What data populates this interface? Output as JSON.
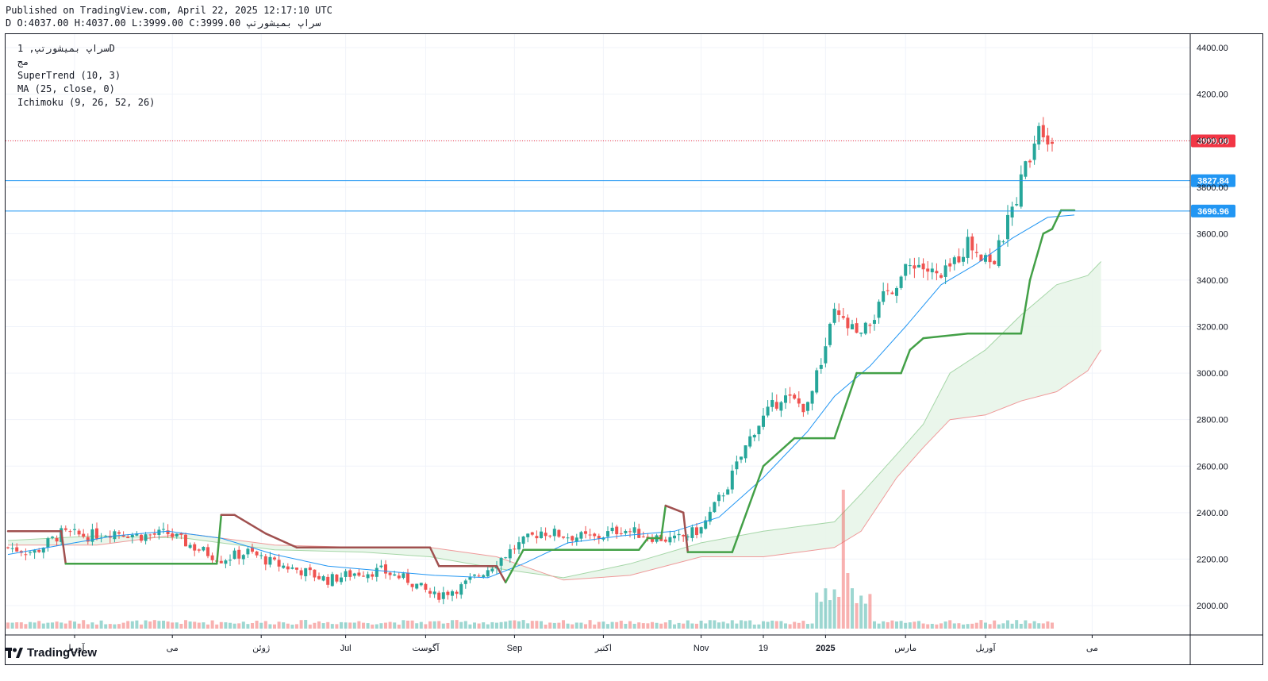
{
  "header": {
    "published": "Published on TradingView.com, April 22, 2025 12:17:10 UTC",
    "ohlc_line": "سراپ بمیشورتپ D O:4037.00 H:4037.00 L:3999.00 C:3999.00"
  },
  "legend": {
    "symbol": "سراپ بمیشورتپ, 1D",
    "exchange": "مج",
    "supertrend": "SuperTrend (10, 3)",
    "ma": "MA (25, close, 0)",
    "ichimoku": "Ichimoku (9, 26, 52, 26)"
  },
  "logo": {
    "text": "TradingView"
  },
  "chart_data": {
    "type": "candlestick",
    "ylim": [
      1950,
      4450
    ],
    "y_ticks": [
      2000,
      2200,
      2400,
      2600,
      2800,
      3000,
      3200,
      3400,
      3600,
      3800,
      4000,
      4200,
      4400
    ],
    "y_tick_labels": [
      "2000.00",
      "2200.00",
      "2400.00",
      "2600.00",
      "2800.00",
      "3000.00",
      "3200.00",
      "3400.00",
      "3600.00",
      "3800.00",
      "4000.00",
      "4200.00",
      "4400.00"
    ],
    "x_labels": [
      "آوریل",
      "می",
      "ژوئن",
      "Jul",
      "آگوست",
      "Sep",
      "اکتبر",
      "Nov",
      "19",
      "2025",
      "مارس",
      "آوریل",
      "می"
    ],
    "x_label_index": [
      15,
      37,
      57,
      76,
      94,
      114,
      134,
      156,
      170,
      184,
      202,
      220,
      244
    ],
    "n_bars": 236,
    "price_lines": [
      {
        "value": 3999.0,
        "label": "3999.00",
        "color": "#f23645",
        "style": "dotted"
      },
      {
        "value": 3827.84,
        "label": "3827.84",
        "color": "#2196f3",
        "style": "solid"
      },
      {
        "value": 3696.96,
        "label": "3696.96",
        "color": "#2196f3",
        "style": "solid"
      }
    ],
    "close_anchors": [
      [
        0,
        2250
      ],
      [
        6,
        2230
      ],
      [
        12,
        2310
      ],
      [
        18,
        2300
      ],
      [
        24,
        2320
      ],
      [
        30,
        2300
      ],
      [
        36,
        2310
      ],
      [
        42,
        2250
      ],
      [
        48,
        2200
      ],
      [
        54,
        2230
      ],
      [
        60,
        2180
      ],
      [
        66,
        2150
      ],
      [
        72,
        2110
      ],
      [
        78,
        2140
      ],
      [
        84,
        2150
      ],
      [
        90,
        2110
      ],
      [
        96,
        2040
      ],
      [
        102,
        2080
      ],
      [
        108,
        2160
      ],
      [
        114,
        2250
      ],
      [
        120,
        2320
      ],
      [
        126,
        2300
      ],
      [
        132,
        2290
      ],
      [
        138,
        2330
      ],
      [
        144,
        2300
      ],
      [
        150,
        2280
      ],
      [
        156,
        2330
      ],
      [
        162,
        2520
      ],
      [
        168,
        2760
      ],
      [
        174,
        2900
      ],
      [
        180,
        2850
      ],
      [
        186,
        3250
      ],
      [
        192,
        3150
      ],
      [
        198,
        3350
      ],
      [
        204,
        3480
      ],
      [
        210,
        3400
      ],
      [
        216,
        3560
      ],
      [
        222,
        3480
      ],
      [
        226,
        3700
      ],
      [
        230,
        3950
      ],
      [
        232,
        4080
      ],
      [
        235,
        3999
      ]
    ],
    "supertrend": [
      [
        0,
        2320,
        "down"
      ],
      [
        12,
        2320,
        "down"
      ],
      [
        13,
        2180,
        "up"
      ],
      [
        47,
        2180,
        "up"
      ],
      [
        48,
        2390,
        "down"
      ],
      [
        51,
        2390,
        "down"
      ],
      [
        58,
        2310,
        "down"
      ],
      [
        65,
        2250,
        "down"
      ],
      [
        95,
        2250,
        "down"
      ],
      [
        97,
        2170,
        "down"
      ],
      [
        110,
        2170,
        "down"
      ],
      [
        112,
        2100,
        "up"
      ],
      [
        116,
        2240,
        "up"
      ],
      [
        142,
        2240,
        "up"
      ],
      [
        144,
        2290,
        "up"
      ],
      [
        147,
        2290,
        "up"
      ],
      [
        148,
        2430,
        "down"
      ],
      [
        152,
        2400,
        "down"
      ],
      [
        153,
        2230,
        "up"
      ],
      [
        163,
        2230,
        "up"
      ],
      [
        170,
        2600,
        "up"
      ],
      [
        177,
        2720,
        "up"
      ],
      [
        186,
        2720,
        "up"
      ],
      [
        191,
        3000,
        "up"
      ],
      [
        201,
        3000,
        "up"
      ],
      [
        203,
        3100,
        "up"
      ],
      [
        206,
        3150,
        "up"
      ],
      [
        216,
        3170,
        "up"
      ],
      [
        228,
        3170,
        "up"
      ],
      [
        230,
        3400,
        "up"
      ],
      [
        233,
        3600,
        "up"
      ],
      [
        235,
        3620,
        "up"
      ],
      [
        237,
        3700,
        "up"
      ],
      [
        240,
        3700,
        "up"
      ]
    ],
    "ma": [
      [
        0,
        2220
      ],
      [
        12,
        2260
      ],
      [
        24,
        2300
      ],
      [
        36,
        2320
      ],
      [
        48,
        2290
      ],
      [
        60,
        2220
      ],
      [
        72,
        2170
      ],
      [
        84,
        2150
      ],
      [
        96,
        2130
      ],
      [
        108,
        2120
      ],
      [
        116,
        2180
      ],
      [
        126,
        2270
      ],
      [
        138,
        2300
      ],
      [
        150,
        2320
      ],
      [
        160,
        2380
      ],
      [
        170,
        2550
      ],
      [
        180,
        2750
      ],
      [
        186,
        2900
      ],
      [
        194,
        3030
      ],
      [
        202,
        3200
      ],
      [
        210,
        3380
      ],
      [
        218,
        3470
      ],
      [
        226,
        3580
      ],
      [
        234,
        3670
      ],
      [
        240,
        3680
      ]
    ],
    "cloud_a": [
      [
        0,
        2280
      ],
      [
        20,
        2300
      ],
      [
        40,
        2290
      ],
      [
        60,
        2240
      ],
      [
        80,
        2230
      ],
      [
        95,
        2210
      ],
      [
        110,
        2160
      ],
      [
        125,
        2120
      ],
      [
        140,
        2180
      ],
      [
        156,
        2270
      ],
      [
        170,
        2320
      ],
      [
        186,
        2360
      ],
      [
        192,
        2480
      ],
      [
        200,
        2650
      ],
      [
        206,
        2780
      ],
      [
        212,
        3000
      ],
      [
        220,
        3100
      ],
      [
        228,
        3250
      ],
      [
        236,
        3380
      ],
      [
        243,
        3420
      ],
      [
        246,
        3480
      ]
    ],
    "cloud_b": [
      [
        0,
        2260
      ],
      [
        20,
        2260
      ],
      [
        40,
        2310
      ],
      [
        60,
        2260
      ],
      [
        80,
        2250
      ],
      [
        95,
        2250
      ],
      [
        110,
        2210
      ],
      [
        125,
        2110
      ],
      [
        140,
        2130
      ],
      [
        156,
        2210
      ],
      [
        170,
        2210
      ],
      [
        186,
        2250
      ],
      [
        192,
        2320
      ],
      [
        200,
        2550
      ],
      [
        206,
        2680
      ],
      [
        212,
        2800
      ],
      [
        220,
        2820
      ],
      [
        228,
        2880
      ],
      [
        236,
        2920
      ],
      [
        243,
        3010
      ],
      [
        246,
        3100
      ]
    ]
  },
  "colors": {
    "up": "#26a69a",
    "down": "#ef5350",
    "supertrend_up": "#43a047",
    "supertrend_down": "#a0504f",
    "ma": "#2196f3",
    "cloud_up": "#e8f5e9",
    "cloud_down": "#fde8e8"
  }
}
